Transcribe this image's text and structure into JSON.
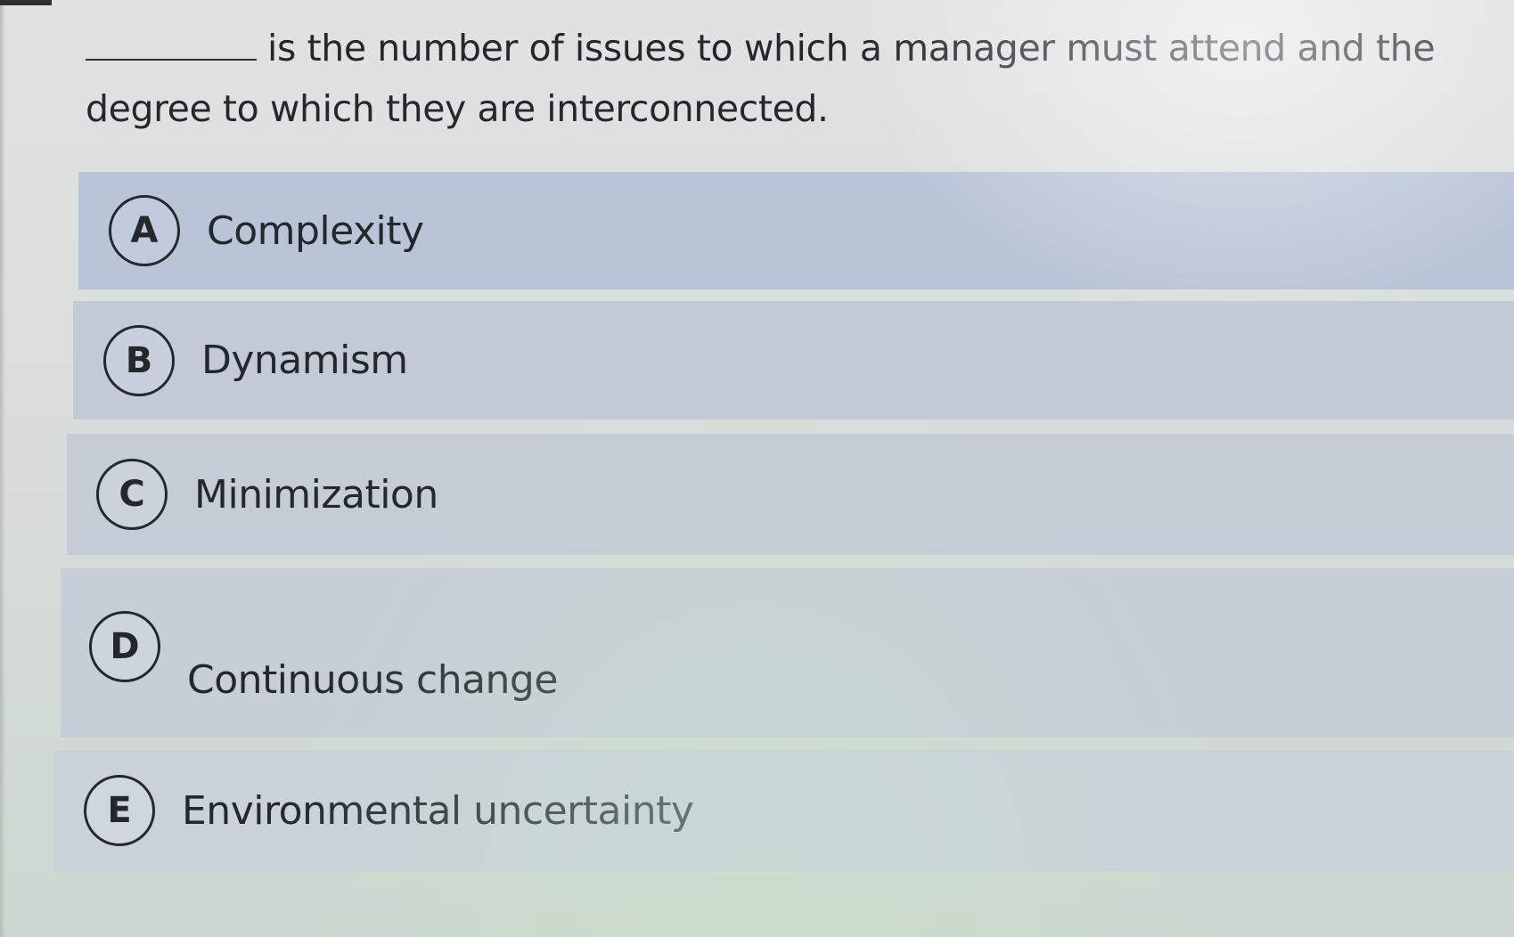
{
  "question": {
    "blank": "________",
    "text": "is the number of issues to which a manager must attend and the degree to which they are interconnected."
  },
  "options": [
    {
      "letter": "A",
      "label": "Complexity"
    },
    {
      "letter": "B",
      "label": "Dynamism"
    },
    {
      "letter": "C",
      "label": "Minimization"
    },
    {
      "letter": "D",
      "label": "Continuous change"
    },
    {
      "letter": "E",
      "label": "Environmental uncertainty"
    }
  ],
  "colors": {
    "option_a_bg": "#b9c4d6",
    "option_bg": "#c5ccd6",
    "text": "#24282d",
    "page_bg": "#d9dedb"
  }
}
